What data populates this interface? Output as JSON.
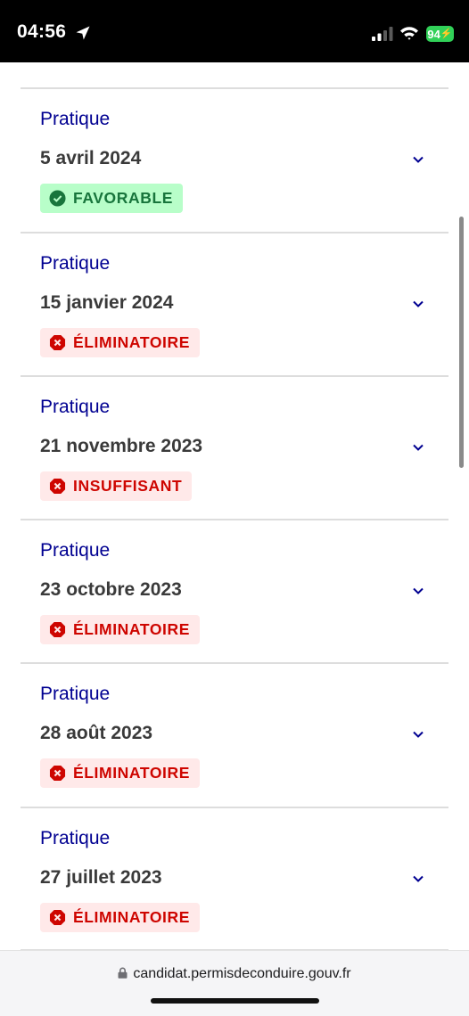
{
  "status_bar": {
    "time": "04:56",
    "battery": "94"
  },
  "results": [
    {
      "type": "Pratique",
      "date": "5 avril 2024",
      "status": "FAVORABLE",
      "kind": "ok"
    },
    {
      "type": "Pratique",
      "date": "15 janvier 2024",
      "status": "ÉLIMINATOIRE",
      "kind": "ko"
    },
    {
      "type": "Pratique",
      "date": "21 novembre 2023",
      "status": "INSUFFISANT",
      "kind": "ko"
    },
    {
      "type": "Pratique",
      "date": "23 octobre 2023",
      "status": "ÉLIMINATOIRE",
      "kind": "ko"
    },
    {
      "type": "Pratique",
      "date": "28 août 2023",
      "status": "ÉLIMINATOIRE",
      "kind": "ko"
    },
    {
      "type": "Pratique",
      "date": "27 juillet 2023",
      "status": "ÉLIMINATOIRE",
      "kind": "ko"
    }
  ],
  "browser": {
    "url": "candidat.permisdeconduire.gouv.fr"
  },
  "colors": {
    "accent": "#000091",
    "success_bg": "#b8fec9",
    "success_fg": "#18753c",
    "error_bg": "#ffe9e9",
    "error_fg": "#ce0500"
  },
  "icons": {
    "success": "check-circle-icon",
    "error": "close-circle-icon",
    "expand": "chevron-down-icon"
  }
}
